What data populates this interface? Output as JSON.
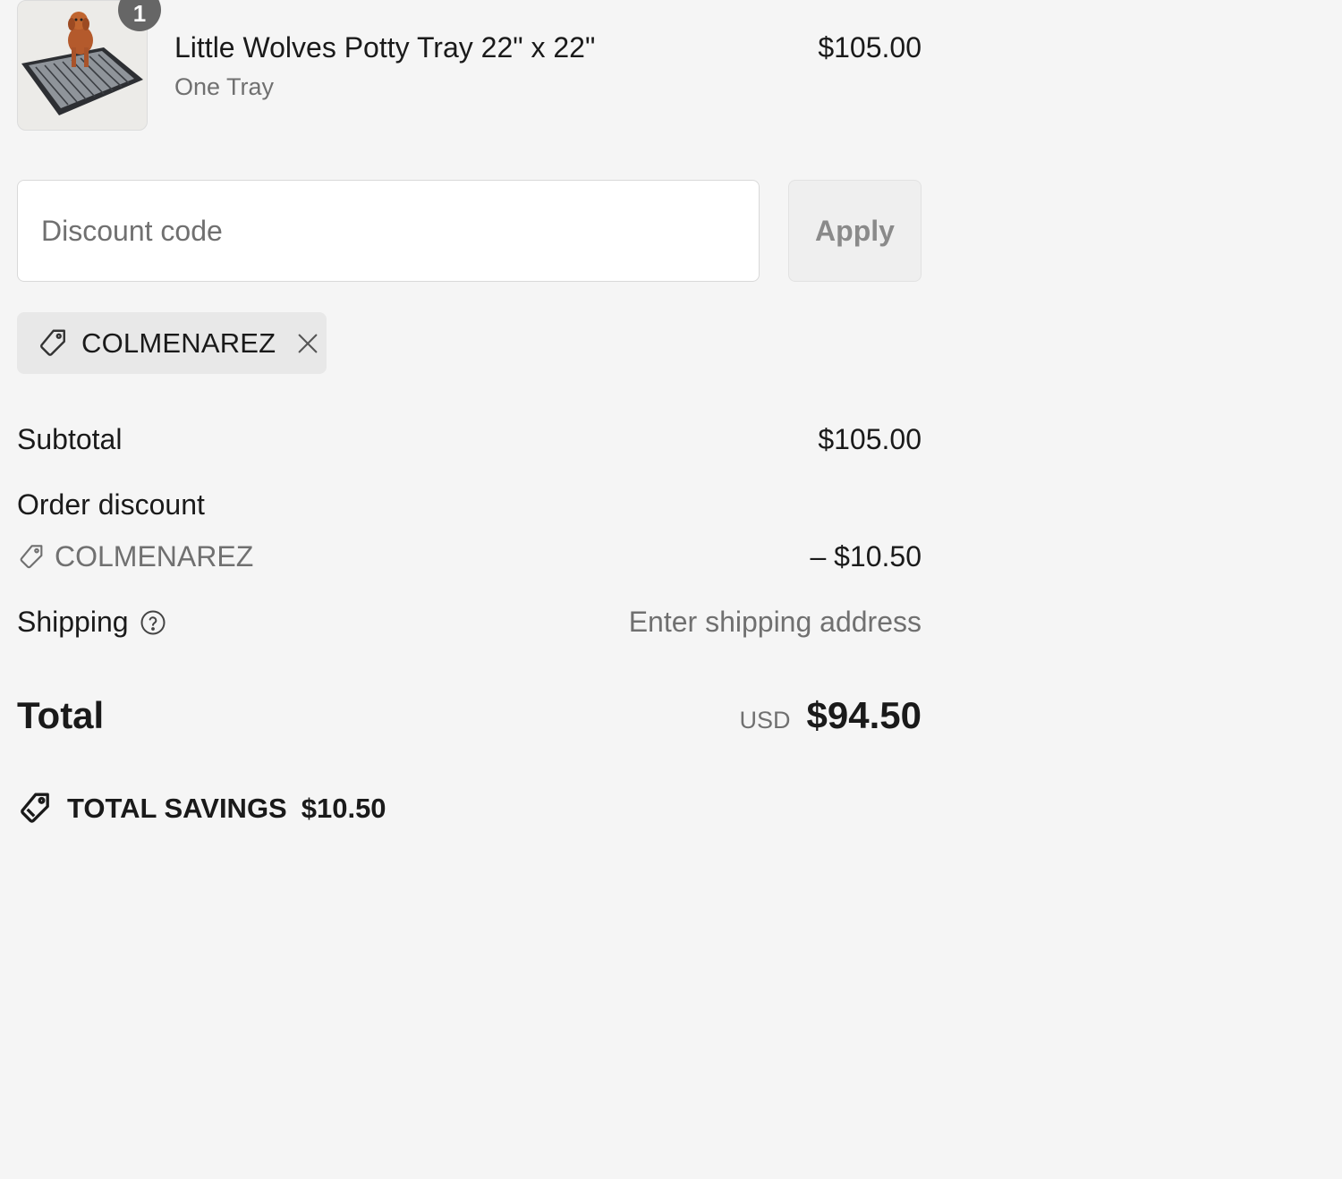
{
  "line_item": {
    "quantity": "1",
    "title": "Little Wolves Potty Tray 22\" x 22\"",
    "variant": "One Tray",
    "price": "$105.00",
    "image_icon": "product-photo-dog-on-tray"
  },
  "discount": {
    "placeholder": "Discount code",
    "apply_label": "Apply",
    "applied_code": "COLMENAREZ",
    "chip_icon": "tag-icon",
    "remove_icon": "close-icon"
  },
  "totals": {
    "subtotal_label": "Subtotal",
    "subtotal_value": "$105.00",
    "order_discount_label": "Order discount",
    "discount_code": "COLMENAREZ",
    "discount_value": "– $10.50",
    "shipping_label": "Shipping",
    "shipping_value": "Enter shipping address",
    "total_label": "Total",
    "currency": "USD",
    "total_value": "$94.50"
  },
  "savings": {
    "label": "TOTAL SAVINGS",
    "amount": "$10.50"
  },
  "colors": {
    "background": "#f5f5f5",
    "text": "#1a1a1a",
    "muted": "#707070",
    "badge": "#666666"
  }
}
